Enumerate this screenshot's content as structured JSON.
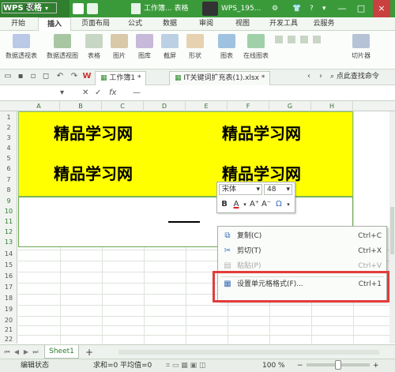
{
  "titlebar": {
    "app_name": "WPS 表格",
    "doc_title": "工作簿... 表格",
    "user": "WPS_195...",
    "minimize": "—",
    "maximize": "□",
    "close": "×"
  },
  "ribbon_tabs": [
    "开始",
    "插入",
    "页面布局",
    "公式",
    "数据",
    "审阅",
    "视图",
    "开发工具",
    "云服务"
  ],
  "active_tab": "插入",
  "ribbon_groups": [
    "数据透视表",
    "数据透视图",
    "表格",
    "图片",
    "图库",
    "截屏",
    "形状",
    "图表",
    "在线图表",
    "切片器"
  ],
  "doc_tabs": [
    {
      "label": "工作簿1 *",
      "active": true
    },
    {
      "label": "IT关键词扩充表(1).xlsx *",
      "active": false
    }
  ],
  "search_label": "点此查找命令",
  "formula": {
    "namebox": "A9",
    "fx": "fx",
    "value": "—"
  },
  "columns": [
    "A",
    "B",
    "C",
    "D",
    "E",
    "F",
    "G",
    "H"
  ],
  "rows": [
    "1",
    "2",
    "3",
    "4",
    "5",
    "6",
    "7",
    "8",
    "9",
    "10",
    "11",
    "12",
    "13",
    "14",
    "15",
    "16",
    "17",
    "18",
    "19",
    "20",
    "21",
    "22",
    "23"
  ],
  "cells": {
    "text1": "精品学习网",
    "text2": "精品学习网",
    "text3": "精品学习网",
    "text4": "精品学习网"
  },
  "mini_toolbar": {
    "font": "宋体",
    "size": "48",
    "bold": "B",
    "font_color": "A",
    "grow": "A⁺",
    "shrink": "A⁻",
    "special": "Ω"
  },
  "context_menu": [
    {
      "label": "复制(C)",
      "shortcut": "Ctrl+C",
      "disabled": false
    },
    {
      "label": "剪切(T)",
      "shortcut": "Ctrl+X",
      "disabled": false
    },
    {
      "label": "粘贴(P)",
      "shortcut": "Ctrl+V",
      "disabled": true
    },
    {
      "label": "设置单元格格式(F)...",
      "shortcut": "Ctrl+1",
      "disabled": false
    }
  ],
  "sheet_tab": "Sheet1",
  "add_sheet": "+",
  "status": {
    "mode": "编辑状态",
    "sum": "求和=0",
    "avg": "平均值=0",
    "zoom": "100 %"
  },
  "colors": {
    "title_green": "#3a9a3a",
    "highlight_yellow": "#ffff00",
    "callout_red": "#e43b3b"
  }
}
